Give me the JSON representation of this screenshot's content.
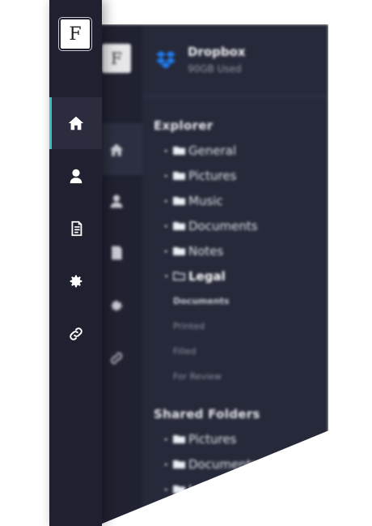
{
  "app": {
    "logo_letter": "F",
    "accent_color": "#35c6c8"
  },
  "rail": {
    "items": [
      {
        "icon": "home-icon",
        "active": true
      },
      {
        "icon": "user-icon",
        "active": false
      },
      {
        "icon": "document-icon",
        "active": false
      },
      {
        "icon": "gear-icon",
        "active": false
      },
      {
        "icon": "link-icon",
        "active": false
      }
    ]
  },
  "storage": {
    "title": "Dropbox",
    "usage": "90GB Used",
    "brand_color": "#1e7ef5"
  },
  "explorer": {
    "title": "Explorer",
    "folders": [
      {
        "label": "General"
      },
      {
        "label": "Pictures"
      },
      {
        "label": "Music"
      },
      {
        "label": "Documents"
      },
      {
        "label": "Notes"
      },
      {
        "label": "Legal"
      }
    ],
    "legal_children": [
      "Documents",
      "Printed",
      "Filled",
      "For Review"
    ]
  },
  "shared": {
    "title": "Shared Folders",
    "folders": [
      {
        "label": "Pictures"
      },
      {
        "label": "Documents"
      },
      {
        "label": "Le"
      }
    ]
  }
}
